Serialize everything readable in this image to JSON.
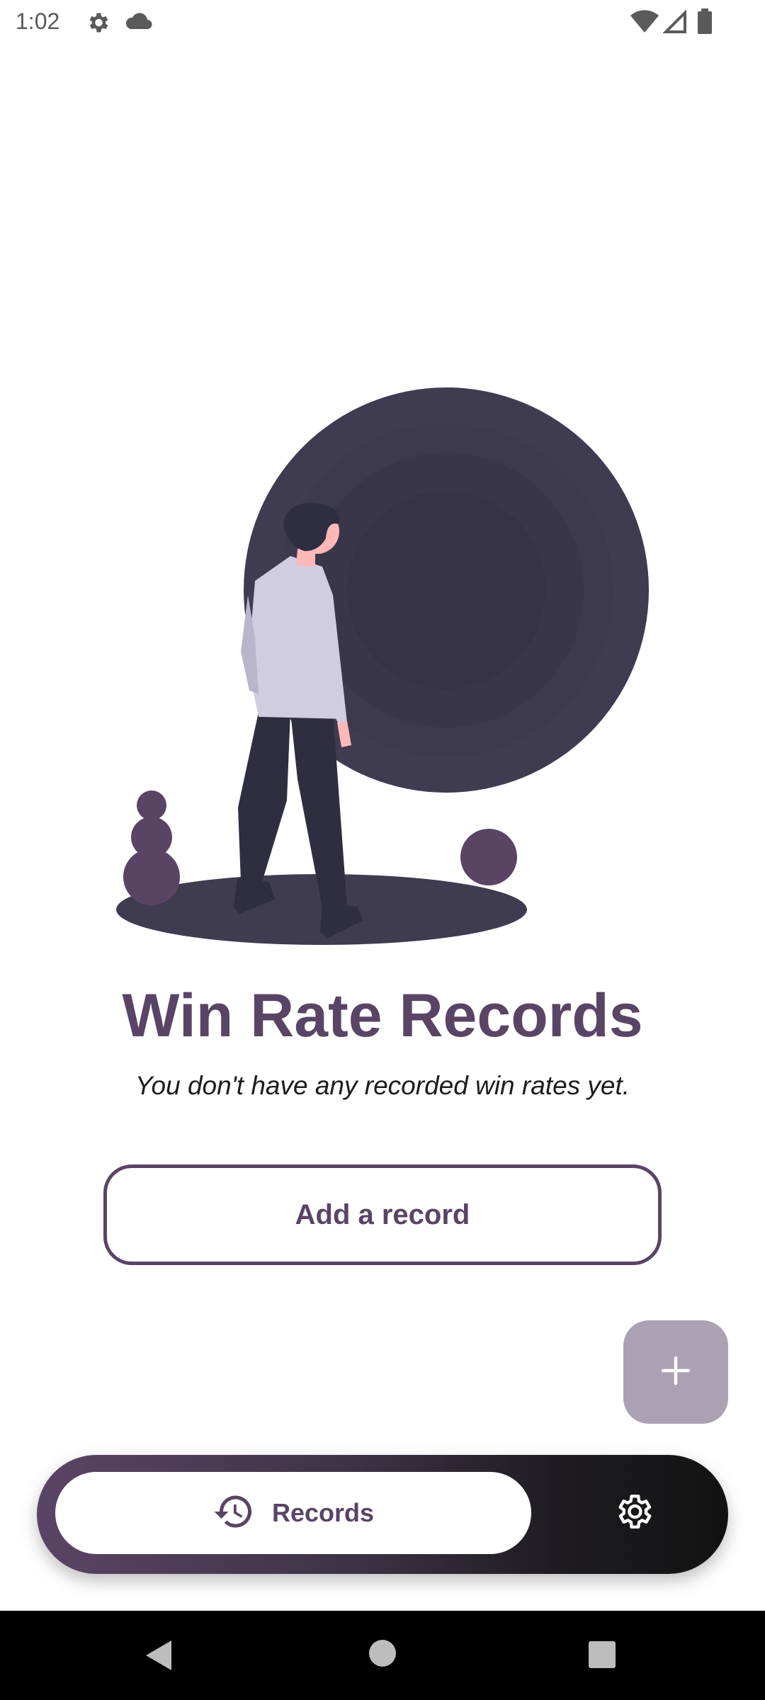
{
  "status_bar": {
    "time": "1:02",
    "icons": [
      "gear-icon",
      "cloud-icon",
      "wifi-icon",
      "cell-signal-icon",
      "battery-icon"
    ]
  },
  "main": {
    "title": "Win Rate Records",
    "subtitle": "You don't have any recorded win rates yet.",
    "add_record_label": "Add a record"
  },
  "fab": {
    "icon": "plus-icon"
  },
  "bottom_nav": {
    "records_label": "Records",
    "records_icon": "history-icon",
    "settings_icon": "gear-icon"
  },
  "system_nav": {
    "icons": [
      "back-icon",
      "home-icon",
      "recents-icon"
    ]
  },
  "colors": {
    "accent": "#5a4466",
    "fab": "#aaa1b3",
    "nav_dark": "#121212",
    "illustration_circle": "#3f3b51"
  }
}
